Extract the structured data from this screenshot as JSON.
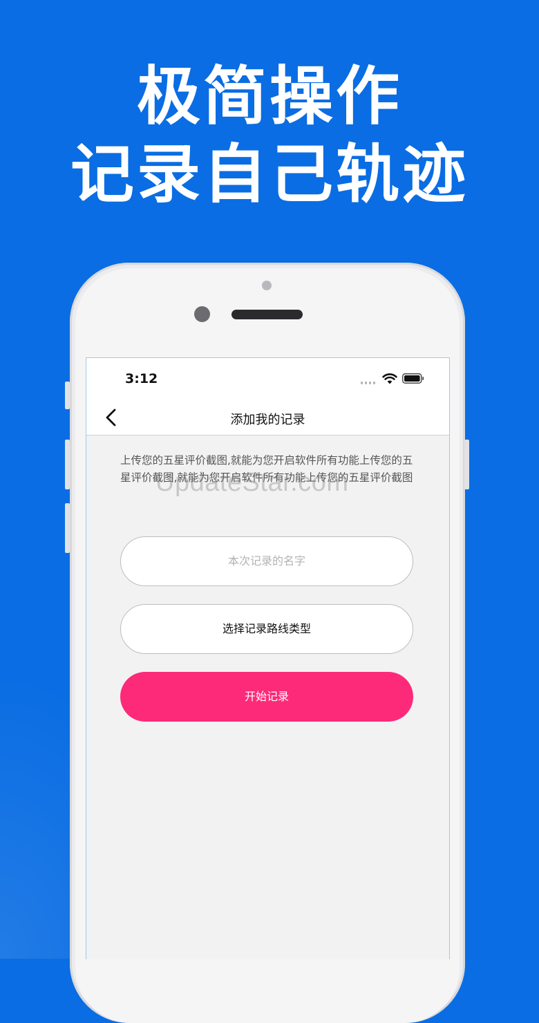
{
  "headline": {
    "line1": "极简操作",
    "line2": "记录自己轨迹"
  },
  "statusbar": {
    "time": "3:12"
  },
  "navbar": {
    "title": "添加我的记录",
    "back_icon": "chevron-left-icon"
  },
  "description": "上传您的五星评价截图,就能为您开启软件所有功能上传您的五星评价截图,就能为您开启软件所有功能上传您的五星评价截图",
  "watermark": "UpdateStar.com",
  "form": {
    "name_placeholder": "本次记录的名字",
    "route_type_label": "选择记录路线类型",
    "start_label": "开始记录"
  },
  "colors": {
    "background": "#0a6de3",
    "start_button": "#fd2a79"
  }
}
